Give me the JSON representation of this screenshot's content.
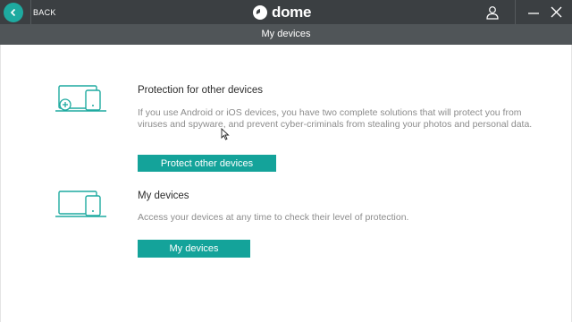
{
  "titlebar": {
    "back_label": "BACK",
    "logo_text": "dome",
    "icons": [
      "back-arrow-icon",
      "dome-logo-icon",
      "user-icon",
      "minimize-icon",
      "close-icon"
    ]
  },
  "subheader": {
    "title": "My devices"
  },
  "sections": [
    {
      "title": "Protection for other devices",
      "description": "If you use Android or iOS devices, you have two complete solutions that will protect you from viruses and spyware, and prevent cyber-criminals from stealing your photos and personal data.",
      "button_label": "Protect other devices",
      "icon": "add-device-icon"
    },
    {
      "title": "My devices",
      "description": "Access your devices at any time to check their level of protection.",
      "button_label": "My devices",
      "icon": "devices-icon"
    }
  ],
  "colors": {
    "accent": "#14a39a",
    "titlebar": "#3b3f42",
    "subheader": "#505558"
  }
}
